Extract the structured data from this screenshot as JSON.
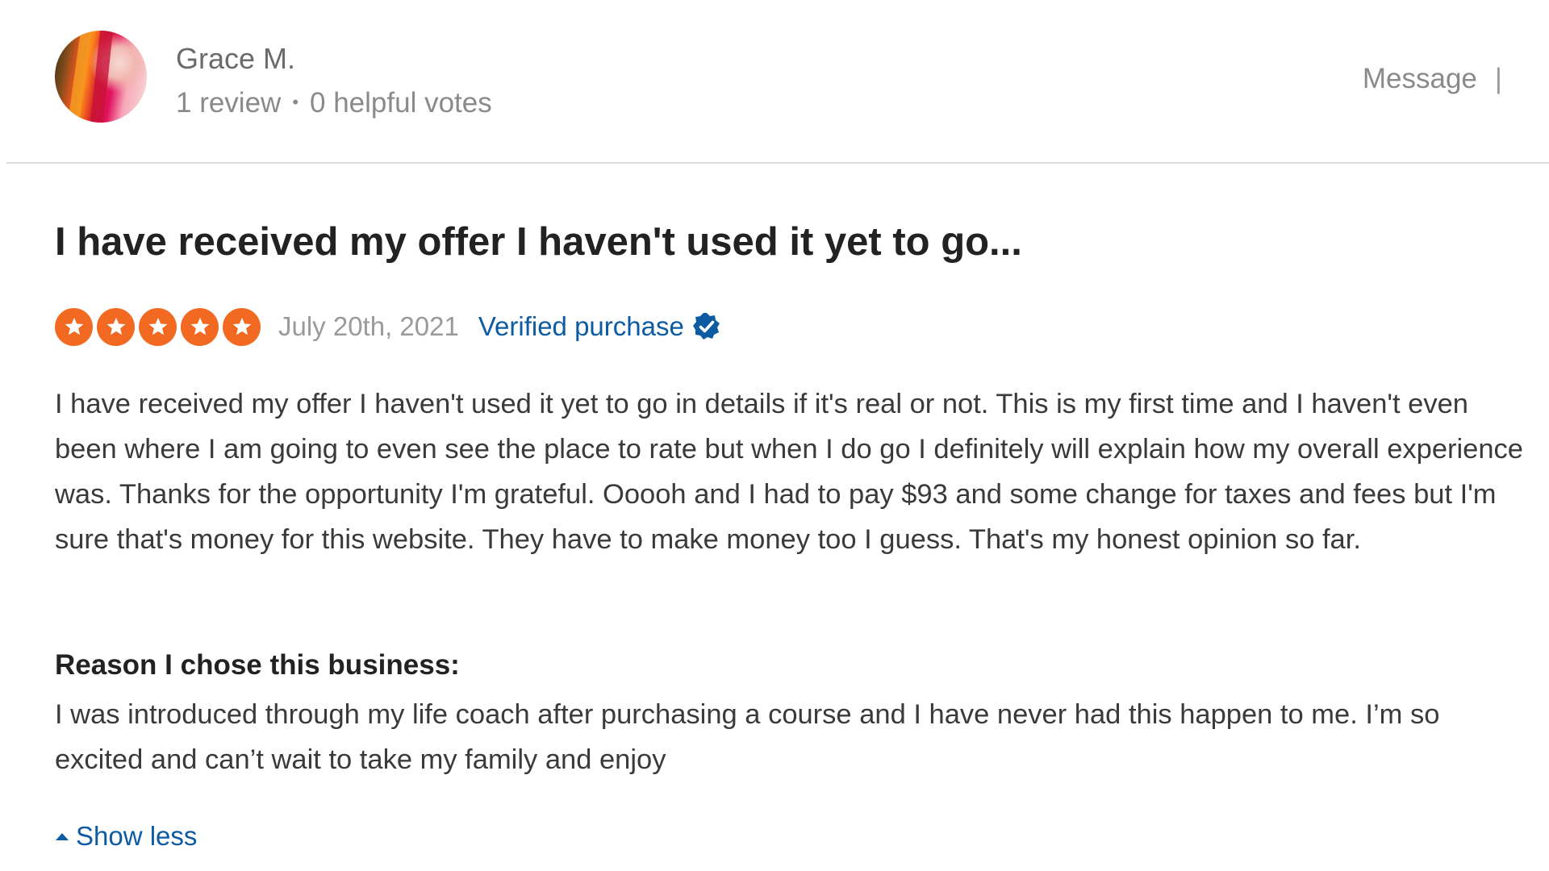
{
  "reviewer": {
    "name": "Grace M.",
    "review_count": "1 review",
    "separator": "•",
    "helpful_votes": "0 helpful votes"
  },
  "actions": {
    "message_label": "Message",
    "separator": "|"
  },
  "review": {
    "title": "I have received my offer I haven't used it yet to go...",
    "rating": 5,
    "rating_max": 5,
    "date": "July 20th, 2021",
    "verified_label": "Verified purchase",
    "body": "I have received my offer I haven't used it yet to go in details if it's real or not. This is my first time and I haven't even been where I am going to even see the place to rate but when I do go I definitely will explain how my overall experience was. Thanks for the opportunity I'm grateful. Ooooh and I had to pay $93 and some change for taxes and fees but I'm sure that's money for this website. They have to make money too I guess. That's my honest opinion so far.",
    "reason_heading": "Reason I chose this business:",
    "reason_body": "I was introduced through my life coach after purchasing a course and I have never had this happen to me. I’m so excited and can’t wait to take my family and enjoy",
    "show_less_label": "Show less"
  },
  "colors": {
    "star": "#f26a21",
    "link": "#0d5ba3",
    "verified_badge": "#0d5ba3"
  },
  "icons": {
    "star": "star-icon",
    "verified": "verified-check-icon",
    "show_less": "caret-up-icon"
  }
}
